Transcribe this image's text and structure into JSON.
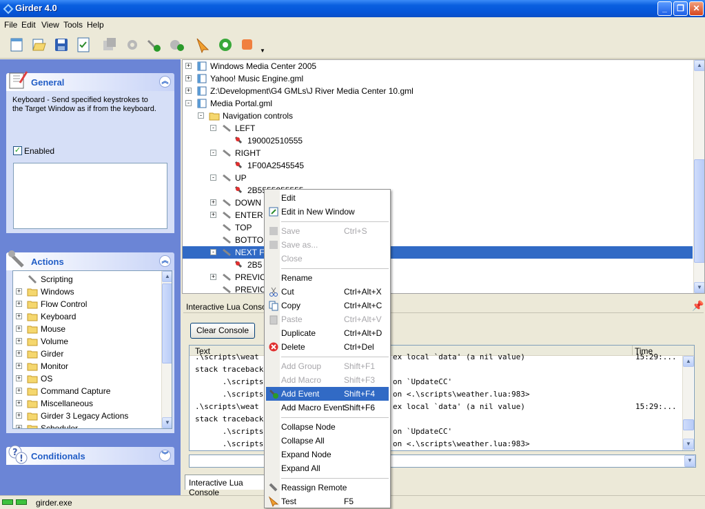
{
  "window": {
    "title": "Girder 4.0"
  },
  "menu": [
    "File",
    "Edit",
    "View",
    "Tools",
    "Help"
  ],
  "general_panel": {
    "title": "General",
    "description": "Keyboard  - Send specified keystrokes to the Target Window as if from the keyboard.",
    "enabled_label": "Enabled",
    "enabled": true
  },
  "actions_panel": {
    "title": "Actions",
    "items": [
      "Scripting",
      "Windows",
      "Flow Control",
      "Keyboard",
      "Mouse",
      "Volume",
      "Girder",
      "Monitor",
      "OS",
      "Command Capture",
      "Miscellaneous",
      "Girder 3 Legacy Actions",
      "Scheduler"
    ]
  },
  "conditionals_panel": {
    "title": "Conditionals"
  },
  "main_tree": {
    "rows": [
      {
        "label": "Windows Media Center 2005",
        "indent": 0,
        "exp": "+"
      },
      {
        "label": "Yahoo! Music Engine.gml",
        "indent": 0,
        "exp": "+"
      },
      {
        "label": "Z:\\Development\\G4 GMLs\\J River Media Center 10.gml",
        "indent": 0,
        "exp": "+"
      },
      {
        "label": "Media Portal.gml",
        "indent": 0,
        "exp": "-"
      },
      {
        "label": "Navigation controls",
        "indent": 1,
        "exp": "-"
      },
      {
        "label": "LEFT",
        "indent": 2,
        "exp": "-"
      },
      {
        "label": "190002510555",
        "indent": 3,
        "exp": ""
      },
      {
        "label": "RIGHT",
        "indent": 2,
        "exp": "-"
      },
      {
        "label": "1F00A2545545",
        "indent": 3,
        "exp": ""
      },
      {
        "label": "UP",
        "indent": 2,
        "exp": "-"
      },
      {
        "label": "2B5555055555",
        "indent": 3,
        "exp": ""
      },
      {
        "label": "DOWN",
        "indent": 2,
        "exp": "+"
      },
      {
        "label": "ENTER",
        "indent": 2,
        "exp": "+"
      },
      {
        "label": "TOP",
        "indent": 2,
        "exp": ""
      },
      {
        "label": "BOTTO",
        "indent": 2,
        "exp": ""
      },
      {
        "label": "NEXT F",
        "indent": 2,
        "exp": "-",
        "selected": true
      },
      {
        "label": "2B5",
        "indent": 3,
        "exp": ""
      },
      {
        "label": "PREVIC",
        "indent": 2,
        "exp": "+"
      },
      {
        "label": "PREVIC",
        "indent": 2,
        "exp": ""
      }
    ]
  },
  "console": {
    "title": "Interactive Lua Console",
    "clear_button": "Clear Console",
    "col_text": "Text",
    "col_time": "Time",
    "lines": [
      {
        "text": ".\\scripts\\weat",
        "tail": "ex local `data' (a nil value)",
        "time": "15:29:..."
      },
      {
        "text": "stack traceback",
        "tail": "",
        "time": ""
      },
      {
        "text": "      .\\scripts\\",
        "tail": "on `UpdateCC'",
        "time": ""
      },
      {
        "text": "      .\\scripts\\",
        "tail": "on <.\\scripts\\weather.lua:983>",
        "time": ""
      },
      {
        "text": ".\\scripts\\weat",
        "tail": "ex local `data' (a nil value)",
        "time": "15:29:..."
      },
      {
        "text": "stack traceback",
        "tail": "",
        "time": ""
      },
      {
        "text": "      .\\scripts\\",
        "tail": "on `UpdateCC'",
        "time": ""
      },
      {
        "text": "      .\\scripts\\",
        "tail": "on <.\\scripts\\weather.lua:983>",
        "time": ""
      }
    ],
    "tab_label": "Interactive Lua Console"
  },
  "context_menu": [
    {
      "label": "Edit",
      "shortcut": "",
      "state": "normal",
      "icon": ""
    },
    {
      "label": "Edit in New Window",
      "shortcut": "",
      "state": "normal",
      "icon": "edit-window-icon"
    },
    {
      "sep": true
    },
    {
      "label": "Save",
      "shortcut": "Ctrl+S",
      "state": "disabled",
      "icon": "save-icon"
    },
    {
      "label": "Save as...",
      "shortcut": "",
      "state": "disabled",
      "icon": "save-as-icon"
    },
    {
      "label": "Close",
      "shortcut": "",
      "state": "disabled",
      "icon": ""
    },
    {
      "sep": true
    },
    {
      "label": "Rename",
      "shortcut": "",
      "state": "normal",
      "icon": ""
    },
    {
      "label": "Cut",
      "shortcut": "Ctrl+Alt+X",
      "state": "normal",
      "icon": "cut-icon"
    },
    {
      "label": "Copy",
      "shortcut": "Ctrl+Alt+C",
      "state": "normal",
      "icon": "copy-icon"
    },
    {
      "label": "Paste",
      "shortcut": "Ctrl+Alt+V",
      "state": "disabled",
      "icon": "paste-icon"
    },
    {
      "label": "Duplicate",
      "shortcut": "Ctrl+Alt+D",
      "state": "normal",
      "icon": ""
    },
    {
      "label": "Delete",
      "shortcut": "Ctrl+Del",
      "state": "normal",
      "icon": "delete-icon"
    },
    {
      "sep": true
    },
    {
      "label": "Add Group",
      "shortcut": "Shift+F1",
      "state": "disabled",
      "icon": ""
    },
    {
      "label": "Add Macro",
      "shortcut": "Shift+F3",
      "state": "disabled",
      "icon": ""
    },
    {
      "label": "Add Event",
      "shortcut": "Shift+F4",
      "state": "selected",
      "icon": "add-event-icon"
    },
    {
      "label": "Add Macro Event",
      "shortcut": "Shift+F6",
      "state": "normal",
      "icon": ""
    },
    {
      "sep": true
    },
    {
      "label": "Collapse Node",
      "shortcut": "",
      "state": "normal",
      "icon": ""
    },
    {
      "label": "Collapse All",
      "shortcut": "",
      "state": "normal",
      "icon": ""
    },
    {
      "label": "Expand Node",
      "shortcut": "",
      "state": "normal",
      "icon": ""
    },
    {
      "label": "Expand All",
      "shortcut": "",
      "state": "normal",
      "icon": ""
    },
    {
      "sep": true
    },
    {
      "label": "Reassign Remote",
      "shortcut": "",
      "state": "normal",
      "icon": "remote-icon"
    },
    {
      "label": "Test",
      "shortcut": "F5",
      "state": "normal",
      "icon": "test-icon"
    }
  ],
  "status": {
    "text": "girder.exe"
  },
  "colors": {
    "selection": "#316ac5",
    "titlebar": "#0556d8",
    "taskpane": "#6b85d6"
  }
}
